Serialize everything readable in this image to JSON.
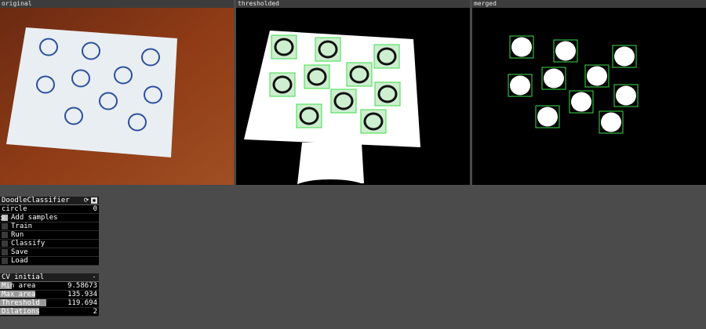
{
  "panels": [
    {
      "title": "original"
    },
    {
      "title": "thresholded"
    },
    {
      "title": "merged"
    }
  ],
  "gui": {
    "title": "DoodleClassifier",
    "refresh_icon": "refresh-icon",
    "minimize_icon": "minimize-icon",
    "class_label": "circle",
    "class_value": "0",
    "toggles": [
      {
        "label": "Add samples",
        "checked": true
      },
      {
        "label": "Train",
        "checked": false
      },
      {
        "label": "Run",
        "checked": false
      },
      {
        "label": "Classify",
        "checked": false
      },
      {
        "label": "Save",
        "checked": false
      },
      {
        "label": "Load",
        "checked": false
      }
    ]
  },
  "cv": {
    "title": "CV initial",
    "collapse_label": "-",
    "sliders": [
      {
        "label": "Min area",
        "value": "9.58673",
        "fraction": 0.12
      },
      {
        "label": "Max area",
        "value": "135.934",
        "fraction": 0.36
      },
      {
        "label": "Threshold",
        "value": "119.694",
        "fraction": 0.47
      },
      {
        "label": "Dilations",
        "value": "2",
        "fraction": 0.4
      }
    ]
  },
  "colors": {
    "background": "#4b4b4b",
    "box": "#3ddc4a",
    "paper": "#e9eef3",
    "ink": "#2b4f9e"
  }
}
